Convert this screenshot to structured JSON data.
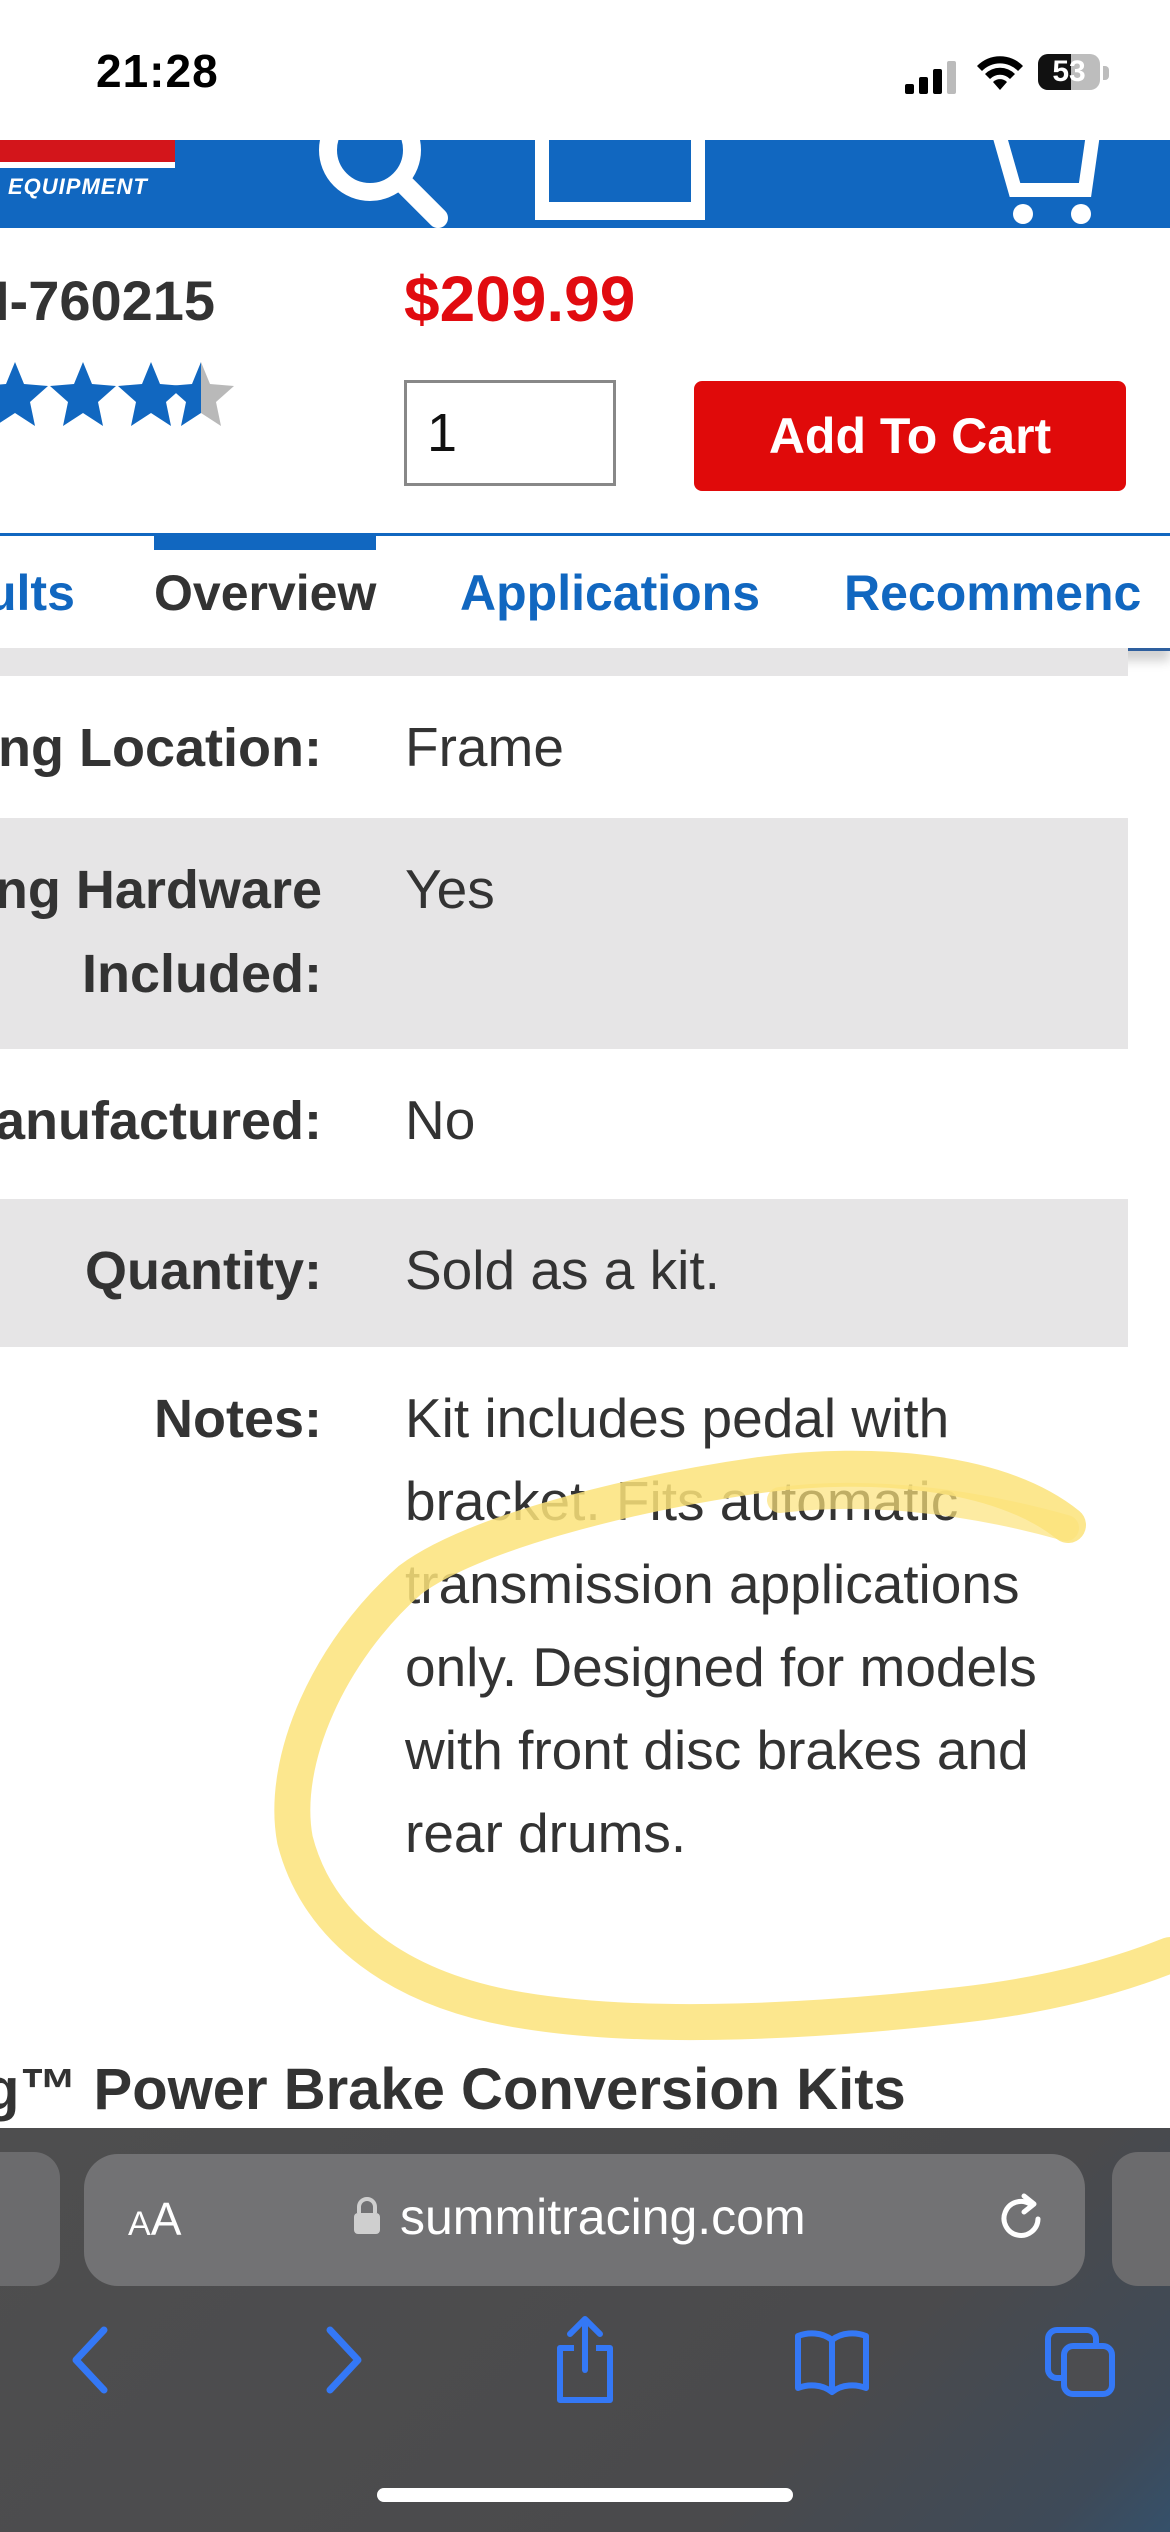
{
  "status_bar": {
    "time": "21:28",
    "battery_percent": "53",
    "icons": [
      "cellular-signal-icon",
      "wifi-icon",
      "battery-icon"
    ]
  },
  "site_header": {
    "logo_text": "EQUIPMENT",
    "icons": [
      "search-icon",
      "truck-icon",
      "cart-icon"
    ],
    "colors": {
      "header_blue": "#1167c0",
      "logo_red": "#d3151b"
    }
  },
  "product": {
    "sku_partial": "I-760215",
    "price": "$209.99",
    "rating": 3.5,
    "review_count_partial": ")",
    "quantity_value": "1",
    "add_to_cart_label": "Add To Cart",
    "colors": {
      "price_red": "#e10b10",
      "button_red": "#e00a0a",
      "star_blue": "#1167c0"
    }
  },
  "tabs": [
    {
      "label": "ults"
    },
    {
      "label": "Overview",
      "active": true
    },
    {
      "label": "Applications"
    },
    {
      "label": "Recommenc"
    }
  ],
  "specs": [
    {
      "label": "ng Location:",
      "value": "Frame"
    },
    {
      "label": "ng Hardware",
      "label_line2": "Included:",
      "value": "Yes"
    },
    {
      "label": "anufactured:",
      "value": "No"
    },
    {
      "label": "Quantity:",
      "value": "Sold as a kit."
    },
    {
      "label": "Notes:",
      "value": "Kit includes pedal with bracket. Fits automatic transmission applications only. Designed for models with front disc brakes and rear drums."
    }
  ],
  "annotation": {
    "color": "#fce37a",
    "note": "yellow highlight circle around notes"
  },
  "section_heading": "g™ Power Brake Conversion Kits",
  "browser": {
    "aa_small": "A",
    "aa_big": "A",
    "url": "summitracing.com",
    "toolbar_icons": [
      "back-icon",
      "forward-icon",
      "share-icon",
      "bookmarks-icon",
      "tabs-icon"
    ],
    "accent": "#3478f6"
  }
}
